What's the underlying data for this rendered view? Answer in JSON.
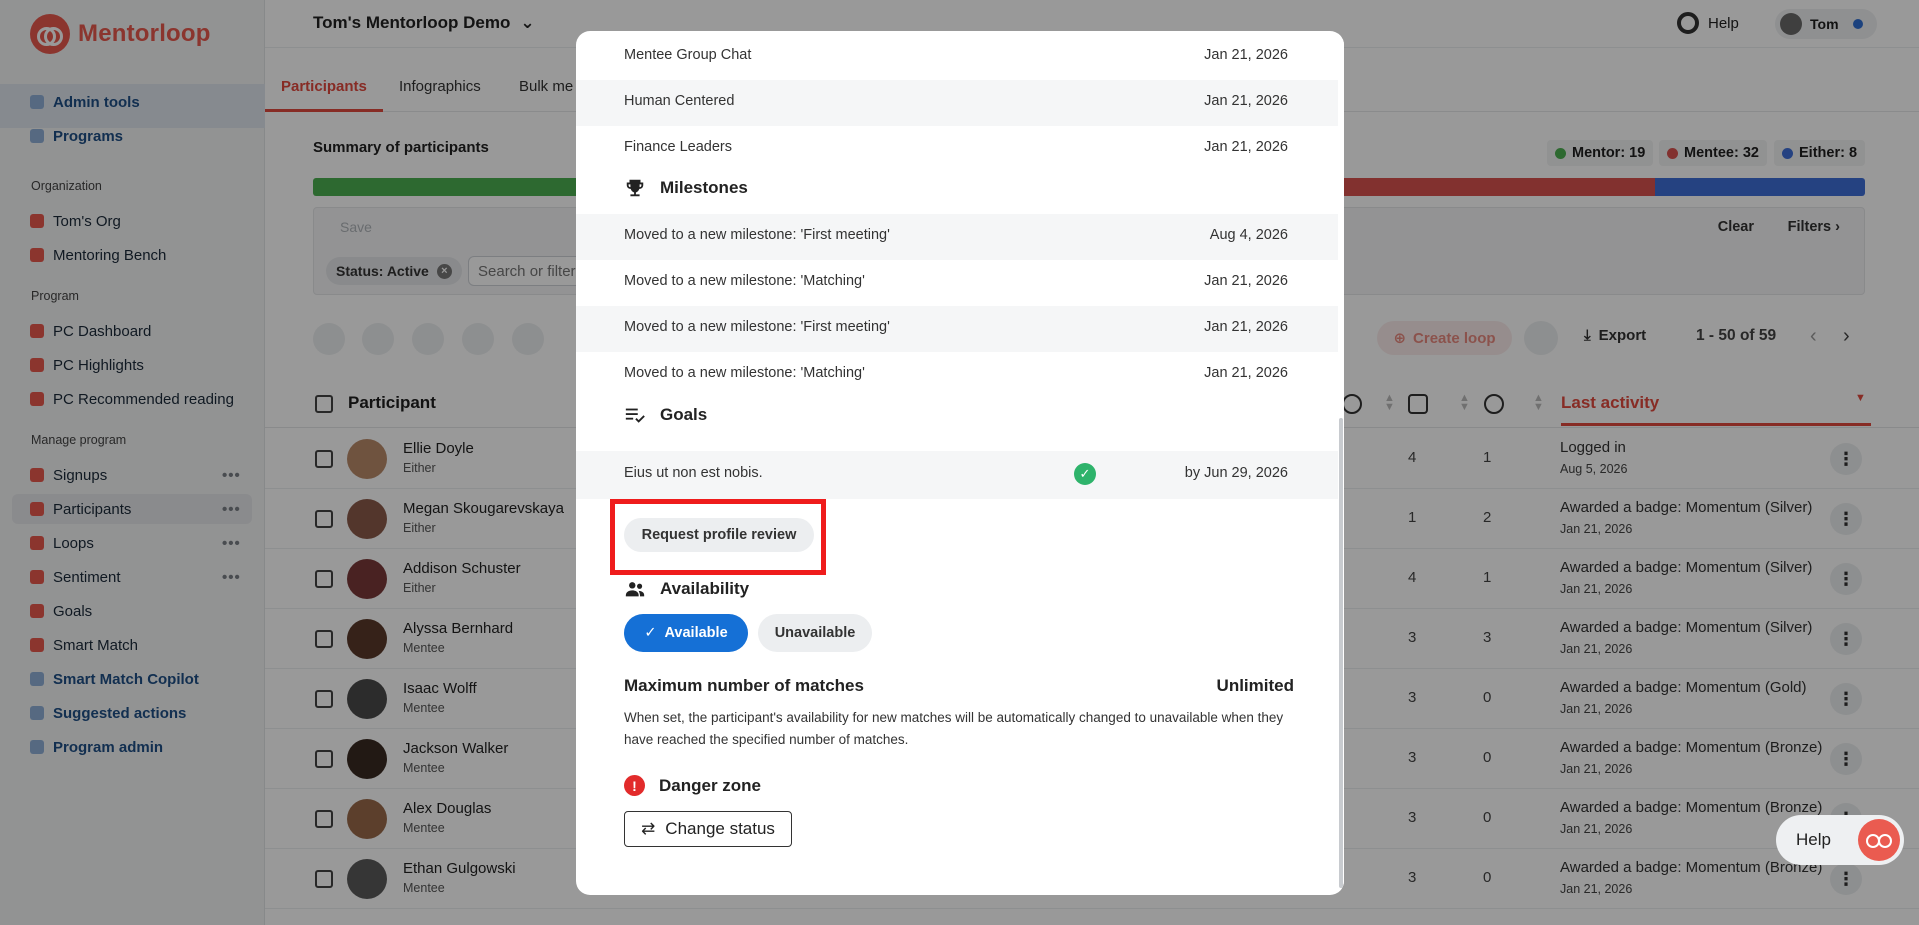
{
  "brand": {
    "name": "Mentorloop",
    "color": "#e8594e"
  },
  "header": {
    "program_title": "Tom's Mentorloop Demo",
    "help_label": "Help",
    "user_name": "Tom"
  },
  "sidebar": {
    "top_items": [
      {
        "label": "Admin tools",
        "icon": "admin-tools-icon"
      },
      {
        "label": "Programs",
        "icon": "programs-icon"
      }
    ],
    "org_heading": "Organization",
    "org_items": [
      {
        "label": "Tom's Org",
        "icon": "globe-icon"
      },
      {
        "label": "Mentoring Bench",
        "icon": "bench-icon"
      }
    ],
    "program_heading": "Program",
    "program_items": [
      {
        "label": "PC Dashboard",
        "icon": "dashboard-icon"
      },
      {
        "label": "PC Highlights",
        "icon": "highlights-icon"
      },
      {
        "label": "PC Recommended reading",
        "icon": "reading-icon"
      }
    ],
    "manage_heading": "Manage program",
    "manage_items": [
      {
        "label": "Signups",
        "icon": "signups-icon"
      },
      {
        "label": "Participants",
        "icon": "participants-icon"
      },
      {
        "label": "Loops",
        "icon": "loops-icon"
      },
      {
        "label": "Sentiment",
        "icon": "sentiment-icon"
      },
      {
        "label": "Goals",
        "icon": "goals-icon"
      },
      {
        "label": "Smart Match",
        "icon": "smart-match-icon"
      },
      {
        "label": "Smart Match Copilot",
        "icon": "sparkle-icon"
      },
      {
        "label": "Suggested actions",
        "icon": "sparkle-icon"
      },
      {
        "label": "Program admin",
        "icon": "wrench-icon"
      }
    ],
    "more_label": "•••"
  },
  "tabs": [
    {
      "label": "Participants",
      "active": true
    },
    {
      "label": "Infographics",
      "active": false
    },
    {
      "label": "Bulk me",
      "active": false
    }
  ],
  "summary": {
    "title": "Summary of participants",
    "mentor": "Mentor: 19",
    "mentee": "Mentee: 32",
    "either": "Either: 8",
    "mentor_count": 19,
    "mentee_count": 32,
    "either_count": 8,
    "colors": {
      "mentor": "#4caf50",
      "mentee": "#d9534f",
      "either": "#3f6fd8"
    }
  },
  "filters": {
    "save_label": "Save",
    "clear_label": "Clear",
    "filters_label": "Filters",
    "status_chip": "Status: Active",
    "search_placeholder": "Search or filter"
  },
  "toolbar": {
    "create_loop": "Create loop",
    "export": "Export",
    "pager": "1 - 50 of 59"
  },
  "table": {
    "col_participant": "Participant",
    "col_last_activity": "Last activity",
    "rows": [
      {
        "name": "Ellie Doyle",
        "role": "Either",
        "c1": "4",
        "c2": "1",
        "activity": "Logged in",
        "date": "Aug 5, 2026"
      },
      {
        "name": "Megan Skougarevskaya",
        "role": "Either",
        "c1": "1",
        "c2": "2",
        "activity": "Awarded a badge: Momentum (Silver)",
        "date": "Jan 21, 2026"
      },
      {
        "name": "Addison Schuster",
        "role": "Either",
        "c1": "4",
        "c2": "1",
        "activity": "Awarded a badge: Momentum (Silver)",
        "date": "Jan 21, 2026"
      },
      {
        "name": "Alyssa Bernhard",
        "role": "Mentee",
        "c1": "3",
        "c2": "3",
        "activity": "Awarded a badge: Momentum (Silver)",
        "date": "Jan 21, 2026"
      },
      {
        "name": "Isaac Wolff",
        "role": "Mentee",
        "c1": "3",
        "c2": "0",
        "activity": "Awarded a badge: Momentum (Gold)",
        "date": "Jan 21, 2026"
      },
      {
        "name": "Jackson Walker",
        "role": "Mentee",
        "c1": "3",
        "c2": "0",
        "activity": "Awarded a badge: Momentum (Bronze)",
        "date": "Jan 21, 2026"
      },
      {
        "name": "Alex Douglas",
        "role": "Mentee",
        "c1": "3",
        "c2": "0",
        "activity": "Awarded a badge: Momentum (Bronze)",
        "date": "Jan 21, 2026"
      },
      {
        "name": "Ethan Gulgowski",
        "role": "Mentee",
        "c1": "3",
        "c2": "0",
        "activity": "Awarded a badge: Momentum (Bronze)",
        "date": "Jan 21, 2026"
      }
    ]
  },
  "modal": {
    "loops": [
      {
        "label": "Mentee Group Chat",
        "date": "Jan 21, 2026"
      },
      {
        "label": "Human Centered",
        "date": "Jan 21, 2026"
      },
      {
        "label": "Finance Leaders",
        "date": "Jan 21, 2026"
      }
    ],
    "milestones_title": "Milestones",
    "milestones": [
      {
        "label": "Moved to a new milestone: 'First meeting'",
        "date": "Aug 4, 2026"
      },
      {
        "label": "Moved to a new milestone: 'Matching'",
        "date": "Jan 21, 2026"
      },
      {
        "label": "Moved to a new milestone: 'First meeting'",
        "date": "Jan 21, 2026"
      },
      {
        "label": "Moved to a new milestone: 'Matching'",
        "date": "Jan 21, 2026"
      }
    ],
    "goals_title": "Goals",
    "goal": {
      "label": "Eius ut non est nobis.",
      "date": "by Jun 29, 2026"
    },
    "request_review": "Request profile review",
    "availability_title": "Availability",
    "available": "Available",
    "unavailable": "Unavailable",
    "max_title": "Maximum number of matches",
    "max_value": "Unlimited",
    "max_desc": "When set, the participant's availability for new matches will be automatically changed to unavailable when they have reached the specified number of matches.",
    "danger_title": "Danger zone",
    "change_status": "Change status"
  },
  "help_fab": "Help"
}
